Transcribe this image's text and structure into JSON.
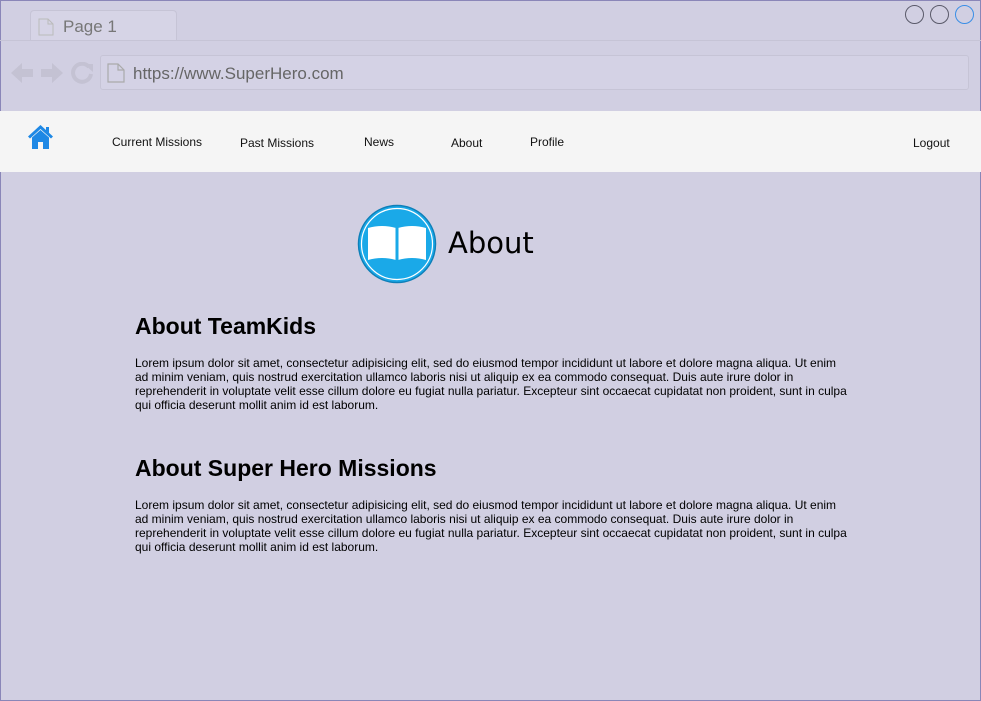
{
  "browser": {
    "tab_title": "Page 1",
    "url": "https://www.SuperHero.com"
  },
  "nav": {
    "links": [
      "Current Missions",
      "Past Missions",
      "News",
      "About",
      "Profile"
    ],
    "logout": "Logout"
  },
  "header": {
    "title": "About",
    "icon": "open-book-icon"
  },
  "sections": [
    {
      "title": "About TeamKids",
      "body": "Lorem ipsum dolor sit amet, consectetur adipisicing elit, sed do eiusmod tempor incididunt ut labore et dolore magna aliqua. Ut enim ad minim veniam, quis nostrud exercitation ullamco laboris nisi ut aliquip ex ea commodo consequat. Duis aute irure dolor in reprehenderit in voluptate velit esse cillum dolore eu fugiat nulla pariatur. Excepteur sint occaecat cupidatat non proident, sunt in culpa qui officia deserunt mollit anim id est laborum."
    },
    {
      "title": "About Super Hero Missions",
      "body": "Lorem ipsum dolor sit amet, consectetur adipisicing elit, sed do eiusmod tempor incididunt ut labore et dolore magna aliqua. Ut enim ad minim veniam, quis nostrud exercitation ullamco laboris nisi ut aliquip ex ea commodo consequat. Duis aute irure dolor in reprehenderit in voluptate velit esse cillum dolore eu fugiat nulla pariatur. Excepteur sint occaecat cupidatat non proident, sunt in culpa qui officia deserunt mollit anim id est laborum."
    }
  ],
  "colors": {
    "background": "#d1cfe2",
    "navbar": "#f5f5f5",
    "accent": "#1aa9e8",
    "home_icon": "#1e88e5"
  }
}
